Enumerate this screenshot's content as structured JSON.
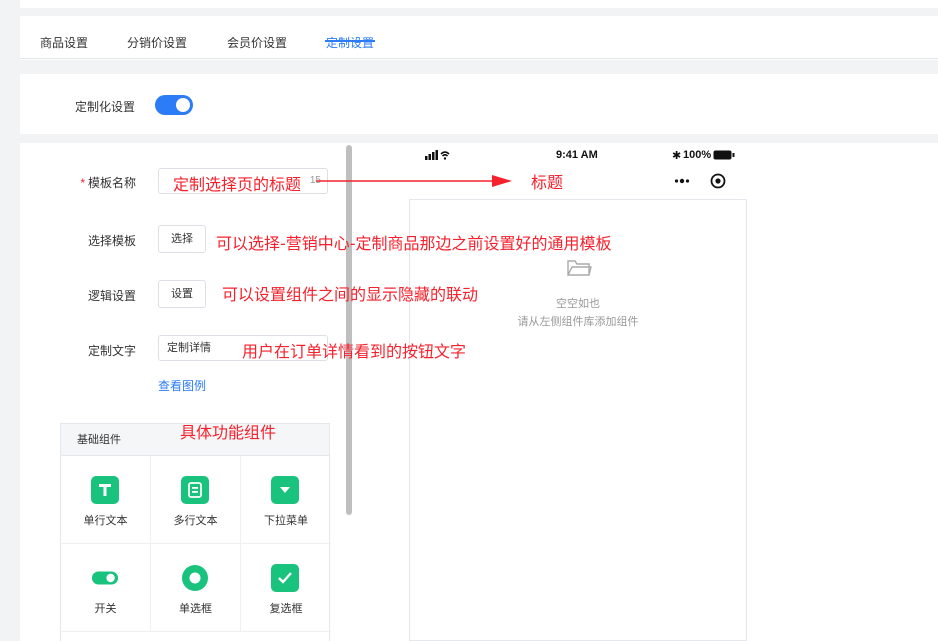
{
  "tabs": [
    {
      "label": "商品设置",
      "active": false
    },
    {
      "label": "分销价设置",
      "active": false
    },
    {
      "label": "会员价设置",
      "active": false
    },
    {
      "label": "定制设置",
      "active": true
    }
  ],
  "custom_toggle": {
    "label": "定制化设置",
    "on": true
  },
  "form": {
    "template_name": {
      "label": "模板名称",
      "required_mark": "*",
      "value": "",
      "counter": "15"
    },
    "select_template": {
      "label": "选择模板",
      "button": "选择"
    },
    "logic_settings": {
      "label": "逻辑设置",
      "button": "设置"
    },
    "custom_text": {
      "label": "定制文字",
      "value": "定制详情"
    },
    "view_example": "查看图例"
  },
  "components": {
    "header": "基础组件",
    "items": [
      {
        "label": "单行文本",
        "icon": "text-t-icon"
      },
      {
        "label": "多行文本",
        "icon": "multiline-text-icon"
      },
      {
        "label": "下拉菜单",
        "icon": "dropdown-icon"
      },
      {
        "label": "开关",
        "icon": "switch-icon"
      },
      {
        "label": "单选框",
        "icon": "radio-icon"
      },
      {
        "label": "复选框",
        "icon": "checkbox-icon"
      }
    ]
  },
  "phone": {
    "time": "9:41 AM",
    "battery": "100%",
    "empty_title": "空空如也",
    "empty_subtitle": "请从左侧组件库添加组件"
  },
  "annotations": {
    "title_page": "定制选择页的标题",
    "title": "标题",
    "select_template": "可以选择-营销中心-定制商品那边之前设置好的通用模板",
    "logic": "可以设置组件之间的显示隐藏的联动",
    "button_text": "用户在订单详情看到的按钮文字",
    "components": "具体功能组件"
  },
  "colors": {
    "accent": "#2b7cf6",
    "annotation": "#f5222d",
    "component": "#19c37d"
  }
}
